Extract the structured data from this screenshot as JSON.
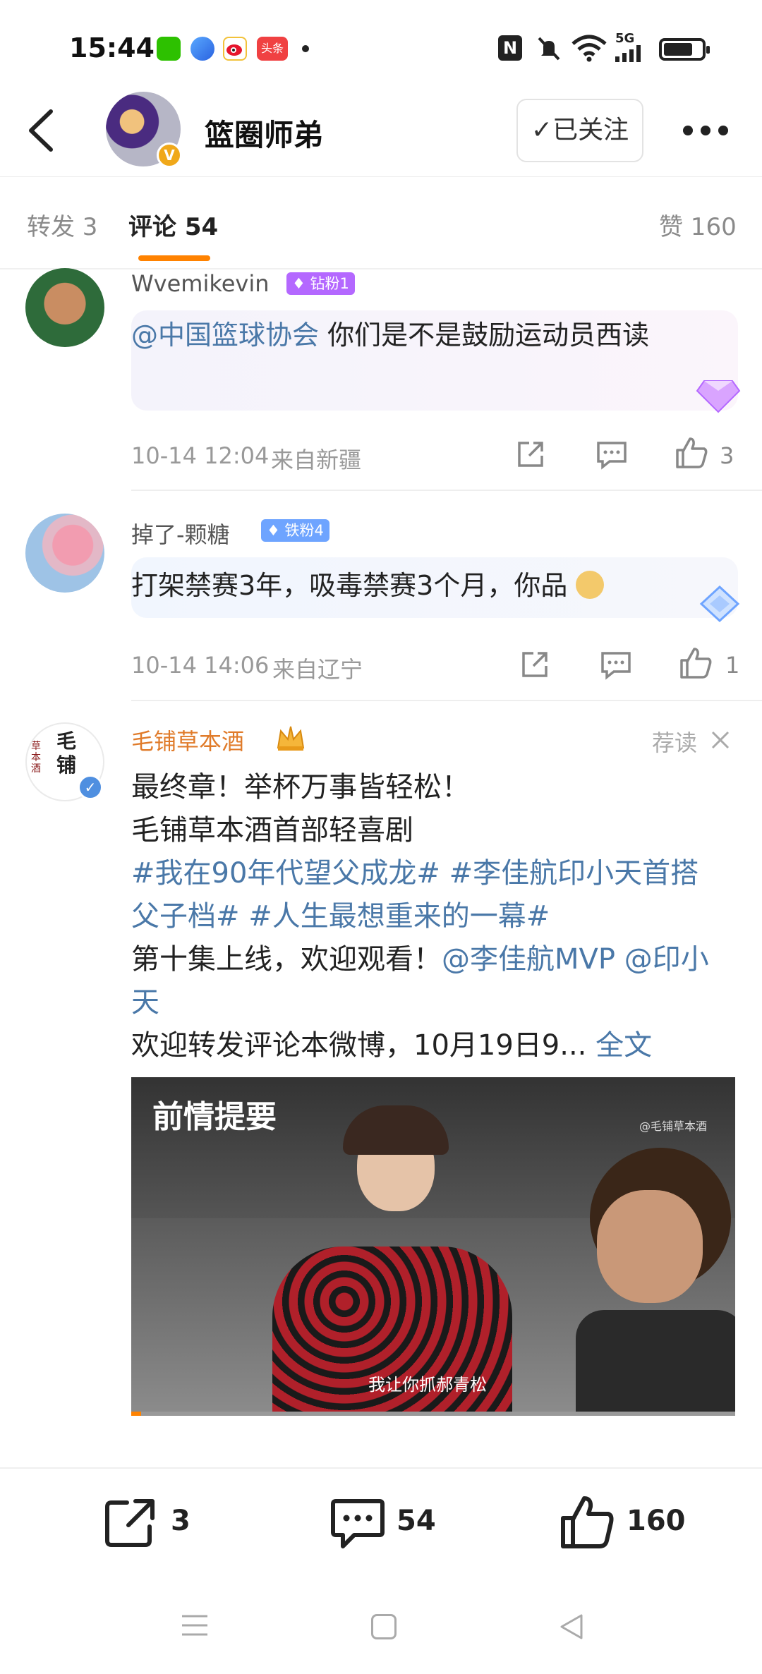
{
  "status_bar": {
    "time": "15:44",
    "app_badge": "头条",
    "network": "5G",
    "icons": [
      "wechat-icon",
      "browser-icon",
      "weibo-icon",
      "toutiao-icon",
      "dot-icon",
      "nfc-icon",
      "mute-icon",
      "wifi-icon",
      "signal-icon",
      "battery-icon"
    ]
  },
  "nav": {
    "title": "篮圈师弟",
    "follow_label": "✓已关注",
    "badge": "V"
  },
  "tabs": {
    "repost": "转发 3",
    "comments": "评论 54",
    "likes": "赞 160"
  },
  "comments": [
    {
      "username": "Wvemikevin",
      "fan_badge": "钻粉1",
      "mention": "@中国篮球协会",
      "text": " 你们是不是鼓励运动员西读",
      "time": "10-14 12:04",
      "location": "来自新疆",
      "like_count": "3"
    },
    {
      "username": "掉了-颗糖",
      "fan_badge": "铁粉4",
      "text": "打架禁赛3年，吸毒禁赛3个月，你品",
      "time": "10-14 14:06",
      "location": "来自辽宁",
      "like_count": "1"
    },
    {
      "username": "毛铺草本酒",
      "avatar_text": "毛铺",
      "avatar_subtext": "草本酒",
      "recommend_label": "荐读",
      "line1": "最终章！举杯万事皆轻松！",
      "line2": "毛铺草本酒首部轻喜剧",
      "topic1": "#我在90年代望父成龙#",
      "topic2": "#李佳航印小天首搭父子档#",
      "topic3": "#人生最想重来的一幕#",
      "line4_prefix": "第十集上线，欢迎观看！",
      "mention1": "@李佳航MVP",
      "mention2": "@印小天",
      "line5": "欢迎转发评论本微博，10月19日9...",
      "more_label": "全文",
      "video": {
        "title": "前情提要",
        "watermark": "@毛铺草本酒",
        "subtitle": "我让你抓郝青松"
      }
    }
  ],
  "bottom_bar": {
    "repost_count": "3",
    "comment_count": "54",
    "like_count": "160"
  },
  "colors": {
    "accent": "#ff8200",
    "link": "#4a78a8",
    "diamond_badge": "#b468ff",
    "iron_badge": "#6ea4ff",
    "orange_name": "#e07b2a"
  }
}
